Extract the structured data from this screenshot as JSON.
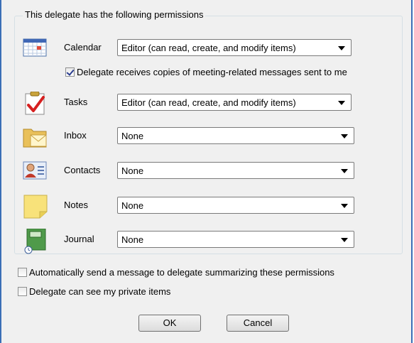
{
  "group_title": "This delegate has the following permissions",
  "rows": [
    {
      "label": "Calendar",
      "value": "Editor (can read, create, and modify items)",
      "icon": "calendar-icon"
    },
    {
      "label": "Tasks",
      "value": "Editor (can read, create, and modify items)",
      "icon": "tasks-icon"
    },
    {
      "label": "Inbox",
      "value": "None",
      "icon": "inbox-icon"
    },
    {
      "label": "Contacts",
      "value": "None",
      "icon": "contacts-icon"
    },
    {
      "label": "Notes",
      "value": "None",
      "icon": "notes-icon"
    },
    {
      "label": "Journal",
      "value": "None",
      "icon": "journal-icon"
    }
  ],
  "meeting_copies": {
    "label": "Delegate receives copies of meeting-related messages sent to me",
    "checked": true
  },
  "auto_send": {
    "label": "Automatically send a message to delegate summarizing these permissions",
    "checked": false
  },
  "private_items": {
    "label": "Delegate can see my private items",
    "checked": false
  },
  "buttons": {
    "ok": "OK",
    "cancel": "Cancel"
  }
}
